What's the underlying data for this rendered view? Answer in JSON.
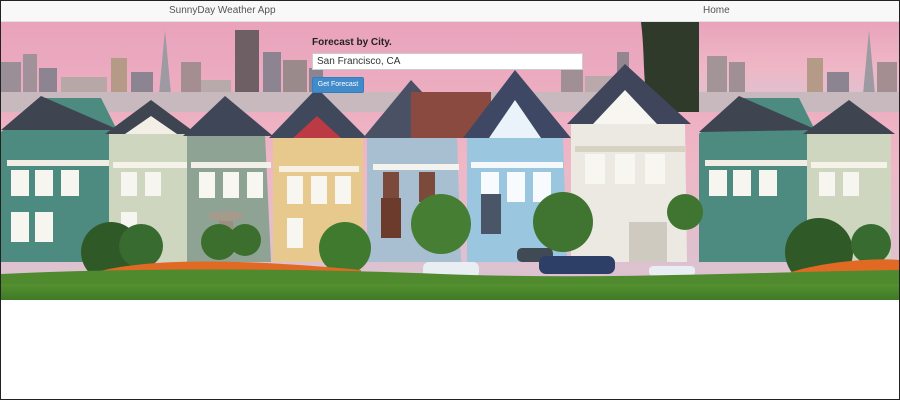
{
  "navbar": {
    "brand": "SunnyDay Weather App",
    "home_link": "Home"
  },
  "forecast_form": {
    "label": "Forecast by City.",
    "city_value": "San Francisco, CA",
    "submit_label": "Get Forecast"
  },
  "hero": {
    "description": "Painted Ladies Victorian houses with San Francisco skyline"
  },
  "colors": {
    "button_blue": "#428bca",
    "sky_pink": "#e8a6bd",
    "grass_green": "#4f8a2f"
  }
}
